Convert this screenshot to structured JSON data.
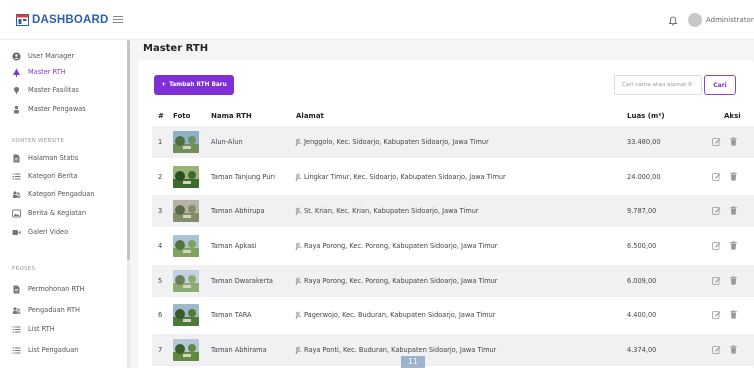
{
  "header": {
    "logo_text": "DASHBOARD",
    "user_name": "Administrator",
    "caret": "˅"
  },
  "sidebar": {
    "items_top": [
      {
        "label": "User Manager",
        "icon": "user-circle-icon"
      },
      {
        "label": "Master RTH",
        "icon": "tree-icon",
        "active": true
      },
      {
        "label": "Master Fasilitas",
        "icon": "pin-icon"
      },
      {
        "label": "Master Pengawas",
        "icon": "person-icon"
      }
    ],
    "section_konten": "KONTEN WEBSITE",
    "items_konten": [
      {
        "label": "Halaman Statis",
        "icon": "file-icon"
      },
      {
        "label": "Kategori Berita",
        "icon": "list-icon"
      },
      {
        "label": "Kategori Pengaduan",
        "icon": "users-icon"
      },
      {
        "label": "Berita & Kegiatan",
        "icon": "image-icon"
      },
      {
        "label": "Galeri Video",
        "icon": "video-icon"
      }
    ],
    "section_proses": "PROSES",
    "items_proses": [
      {
        "label": "Permohonan RTH",
        "icon": "file-icon"
      },
      {
        "label": "Pengaduan RTH",
        "icon": "users-icon"
      },
      {
        "label": "List RTH",
        "icon": "list-icon"
      },
      {
        "label": "List Pengaduan",
        "icon": "list-icon"
      }
    ]
  },
  "main": {
    "title": "Master RTH",
    "add_button": "Tambah RTH Baru",
    "search_placeholder": "Cari nama atau alamat R",
    "search_button": "Cari",
    "columns": [
      "#",
      "Foto",
      "Nama RTH",
      "Alamat",
      "Luas (m²)",
      "Aksi"
    ],
    "rows": [
      {
        "no": "1",
        "nama": "Alun-Alun",
        "alamat": "Jl. Jenggolo, Kec. Sidoarjo, Kabupaten Sidoarjo, Jawa Timur",
        "luas": "33.480,00"
      },
      {
        "no": "2",
        "nama": "Taman Tanjung Puri",
        "alamat": "Jl. Lingkar Timur, Kec. Sidoarjo, Kabupaten Sidoarjo, Jawa Timur",
        "luas": "24.000,00"
      },
      {
        "no": "3",
        "nama": "Taman Abhirupa",
        "alamat": "Jl. St. Krian, Kec. Krian, Kabupaten Sidoarjo, Jawa Timur",
        "luas": "9.787,00"
      },
      {
        "no": "4",
        "nama": "Taman Apkasi",
        "alamat": "Jl. Raya Porong, Kec. Porong, Kabupaten Sidoarjo, Jawa Timur",
        "luas": "6.500,00"
      },
      {
        "no": "5",
        "nama": "Taman Dwarakerta",
        "alamat": "Jl. Raya Porong, Kec. Porong, Kabupaten Sidoarjo, Jawa Timur",
        "luas": "6.009,00"
      },
      {
        "no": "6",
        "nama": "Taman TARA",
        "alamat": "Jl. Pagerwojo, Kec. Buduran, Kabupaten Sidoarjo, Jawa Timur",
        "luas": "4.400,00"
      },
      {
        "no": "7",
        "nama": "Taman Abhirama",
        "alamat": "Jl. Raya Ponti, Kec. Buduran, Kabupaten Sidoarjo, Jawa Timur",
        "luas": "4.374,00"
      }
    ]
  },
  "overlay_badge": "11",
  "colors": {
    "accent": "#7f2fd6",
    "logo": "#2c5fa8",
    "row_alt": "#f1f1f3"
  }
}
